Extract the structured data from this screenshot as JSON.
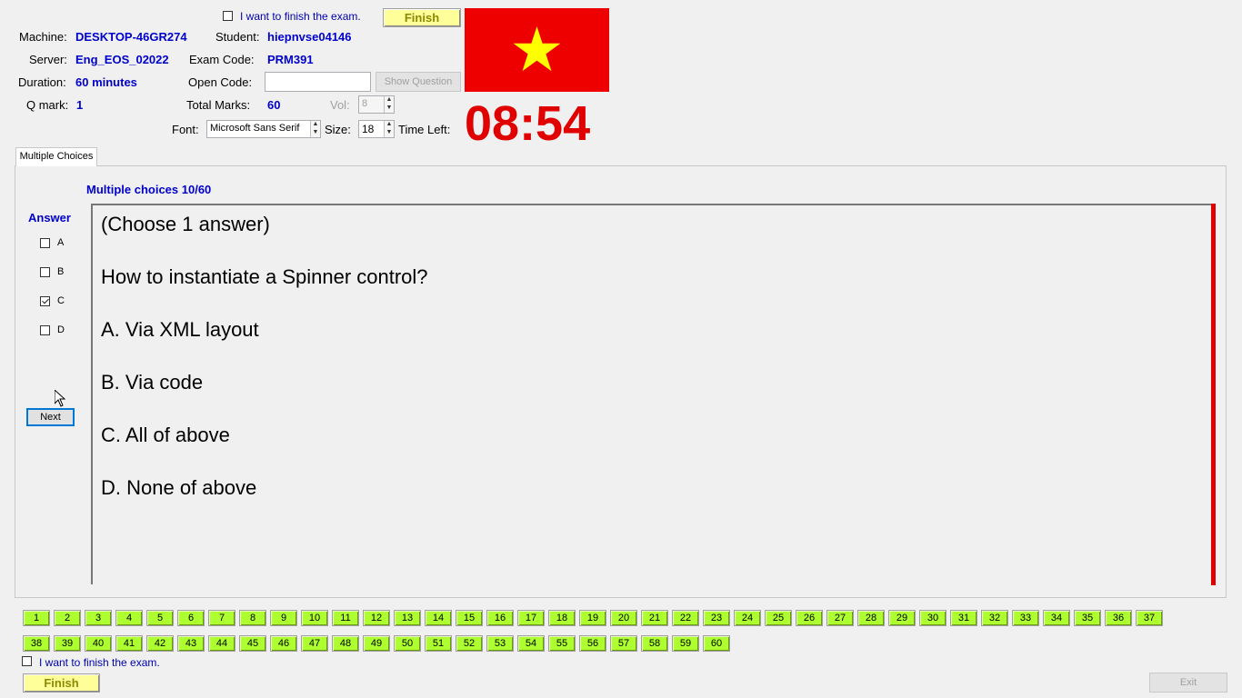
{
  "header": {
    "finish_check_label": "I want to finish the exam.",
    "finish_label": "Finish",
    "machine_label": "Machine:",
    "machine_value": "DESKTOP-46GR274",
    "student_label": "Student:",
    "student_value": "hiepnvse04146",
    "server_label": "Server:",
    "server_value": "Eng_EOS_02022",
    "exam_code_label": "Exam Code:",
    "exam_code_value": "PRM391",
    "duration_label": "Duration:",
    "duration_value": "60 minutes",
    "open_code_label": "Open Code:",
    "open_code_value": "",
    "show_question_label": "Show Question",
    "qmark_label": "Q mark:",
    "qmark_value": "1",
    "total_marks_label": "Total Marks:",
    "total_marks_value": "60",
    "vol_label": "Vol:",
    "vol_value": "8",
    "font_label": "Font:",
    "font_value": "Microsoft Sans Serif",
    "size_label": "Size:",
    "size_value": "18",
    "time_left_label": "Time Left:",
    "time_left_value": "08:54",
    "flag_icon": "vietnam-flag",
    "timer_color": "#e00000"
  },
  "tab": {
    "label": "Multiple Choices",
    "progress": "Multiple choices 10/60"
  },
  "answer": {
    "title": "Answer",
    "options": [
      {
        "label": "A",
        "checked": false
      },
      {
        "label": "B",
        "checked": false
      },
      {
        "label": "C",
        "checked": true
      },
      {
        "label": "D",
        "checked": false
      }
    ],
    "next_label": "Next"
  },
  "question": {
    "lines": [
      "(Choose 1 answer)",
      "How to instantiate a Spinner control?",
      "A.  Via XML layout",
      "B.  Via code",
      "C.  All of above",
      "D.  None of above"
    ]
  },
  "navigation": {
    "row1": [
      "1",
      "2",
      "3",
      "4",
      "5",
      "6",
      "7",
      "8",
      "9",
      "10",
      "11",
      "12",
      "13",
      "14",
      "15",
      "16",
      "17",
      "18",
      "19",
      "20",
      "21",
      "22",
      "23",
      "24",
      "25",
      "26",
      "27",
      "28",
      "29",
      "30",
      "31",
      "32",
      "33",
      "34",
      "35",
      "36",
      "37"
    ],
    "row2": [
      "38",
      "39",
      "40",
      "41",
      "42",
      "43",
      "44",
      "45",
      "46",
      "47",
      "48",
      "49",
      "50",
      "51",
      "52",
      "53",
      "54",
      "55",
      "56",
      "57",
      "58",
      "59",
      "60"
    ],
    "button_color": "#adff2f"
  },
  "footer": {
    "finish_check_label": "I want to finish the exam.",
    "finish_label": "Finish",
    "exit_label": "Exit"
  }
}
